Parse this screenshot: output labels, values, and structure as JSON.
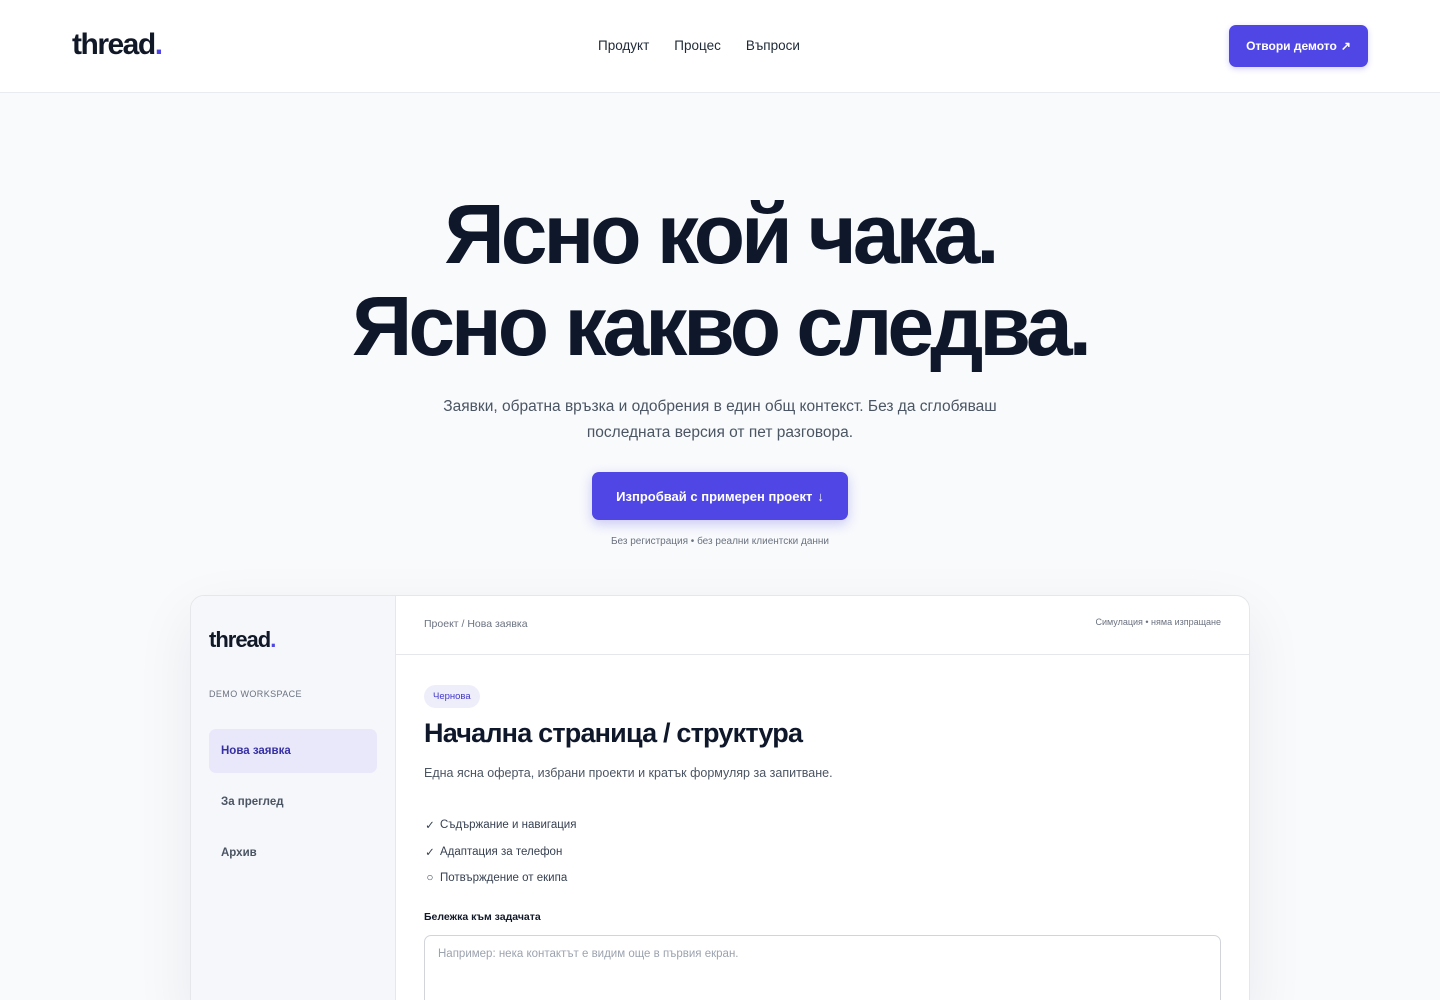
{
  "header": {
    "logo_text": "thread",
    "logo_dot": ".",
    "nav": [
      "Продукт",
      "Процес",
      "Въпроси"
    ],
    "cta_label": "Отвори демото",
    "cta_icon": "↗"
  },
  "hero": {
    "title_line1": "Ясно кой чака.",
    "title_line2": "Ясно какво следва.",
    "subtitle": "Заявки, обратна връзка и одобрения в един общ контекст. Без да сглобяваш последната версия от пет разговора.",
    "cta_label": "Изпробвай с примерен проект",
    "cta_icon": "↓",
    "note": "Без регистрация • без реални клиентски данни"
  },
  "demo": {
    "sidebar": {
      "logo_text": "thread",
      "logo_dot": ".",
      "workspace_label": "DEMO WORKSPACE",
      "items": [
        {
          "label": "Нова заявка",
          "active": true
        },
        {
          "label": "За преглед",
          "active": false
        },
        {
          "label": "Архив",
          "active": false
        }
      ]
    },
    "breadcrumb": "Проект / Нова заявка",
    "simulation_note": "Симулация • няма изпращане",
    "badge": "Чернова",
    "title": "Начална страница / структура",
    "description": "Една ясна оферта, избрани проекти и кратък формуляр за запитване.",
    "checklist": [
      {
        "mark": "✓",
        "label": "Съдържание и навигация",
        "done": true
      },
      {
        "mark": "✓",
        "label": "Адаптация за телефон",
        "done": true
      },
      {
        "mark": "○",
        "label": "Потвърждение от екипа",
        "done": false
      }
    ],
    "note_label": "Бележка към задачата",
    "note_placeholder": "Например: нека контактът е видим още в първия екран.",
    "note_value": ""
  },
  "colors": {
    "accent": "#4f46e5",
    "text": "#0f172a",
    "page_bg": "#f8fafc",
    "sidebar_bg": "#f5f7fb",
    "active_item_bg": "#e9e8fb"
  }
}
